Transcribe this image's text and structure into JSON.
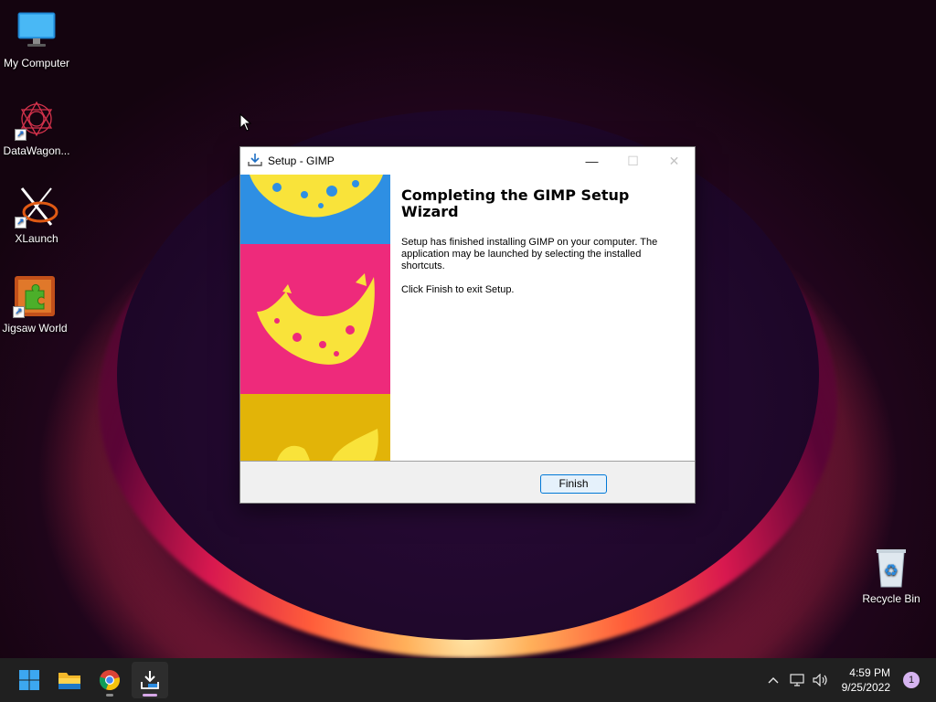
{
  "desktop": {
    "icons": [
      {
        "label": "My Computer",
        "icon": "monitor-icon"
      },
      {
        "label": "DataWagon...",
        "icon": "datawagon-icon"
      },
      {
        "label": "XLaunch",
        "icon": "xlaunch-icon"
      },
      {
        "label": "Jigsaw World",
        "icon": "jigsaw-icon"
      },
      {
        "label": "Recycle Bin",
        "icon": "recycle-bin-icon"
      }
    ]
  },
  "window": {
    "title": "Setup - GIMP",
    "heading": "Completing the GIMP Setup Wizard",
    "message": "Setup has finished installing GIMP on your computer. The application may be launched by selecting the installed shortcuts.",
    "exit_text": "Click Finish to exit Setup.",
    "finish_label": "Finish",
    "controls": {
      "minimize": "—",
      "maximize": "☐",
      "close": "✕"
    }
  },
  "taskbar": {
    "apps": [
      "start-icon",
      "file-explorer-icon",
      "chrome-icon",
      "setup-gimp-icon"
    ],
    "time": "4:59 PM",
    "date": "9/25/2022",
    "notification_count": "1"
  },
  "colors": {
    "accent": "#0078d7",
    "art_blue": "#2e8fe3",
    "art_pink": "#ee2a7b",
    "art_gold": "#e2b408",
    "art_yellow": "#f9e33a"
  }
}
